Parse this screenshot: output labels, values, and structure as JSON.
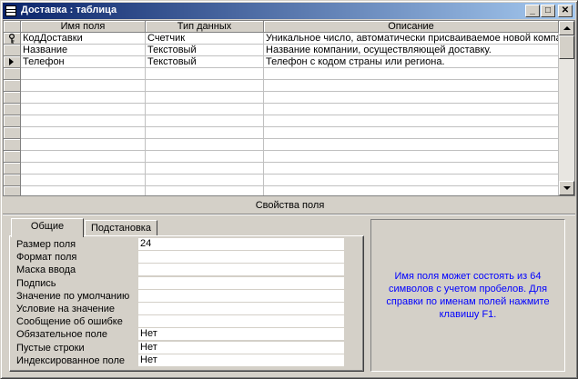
{
  "window": {
    "title": "Доставка : таблица",
    "buttons": {
      "minimize": "_",
      "maximize": "□",
      "close": "✕"
    }
  },
  "grid": {
    "columns": [
      "Имя поля",
      "Тип данных",
      "Описание"
    ],
    "rows": [
      {
        "indicator": "key-icon",
        "name": "КодДоставки",
        "type": "Счетчик",
        "description": "Уникальное число, автоматически присваиваемое новой компании"
      },
      {
        "indicator": "",
        "name": "Название",
        "type": "Текстовый",
        "description": "Название компании, осуществляющей доставку."
      },
      {
        "indicator": "current-row-icon",
        "name": "Телефон",
        "type": "Текстовый",
        "description": "Телефон с кодом страны или региона."
      }
    ]
  },
  "properties": {
    "title": "Свойства поля",
    "tabs": [
      "Общие",
      "Подстановка"
    ],
    "fields": [
      {
        "label": "Размер поля",
        "value": "24"
      },
      {
        "label": "Формат поля",
        "value": ""
      },
      {
        "label": "Маска ввода",
        "value": ""
      },
      {
        "label": "Подпись",
        "value": ""
      },
      {
        "label": "Значение по умолчанию",
        "value": ""
      },
      {
        "label": "Условие на значение",
        "value": ""
      },
      {
        "label": "Сообщение об ошибке",
        "value": ""
      },
      {
        "label": "Обязательное поле",
        "value": "Нет"
      },
      {
        "label": "Пустые строки",
        "value": "Нет"
      },
      {
        "label": "Индексированное поле",
        "value": "Нет"
      }
    ],
    "help": "Имя поля может состоять из 64 символов с учетом пробелов.  Для справки по именам полей нажмите клавишу F1."
  },
  "colors": {
    "titlebar_start": "#0a246a",
    "titlebar_end": "#a6caf0",
    "help_text": "#0000ff",
    "face": "#d4d0c8"
  }
}
